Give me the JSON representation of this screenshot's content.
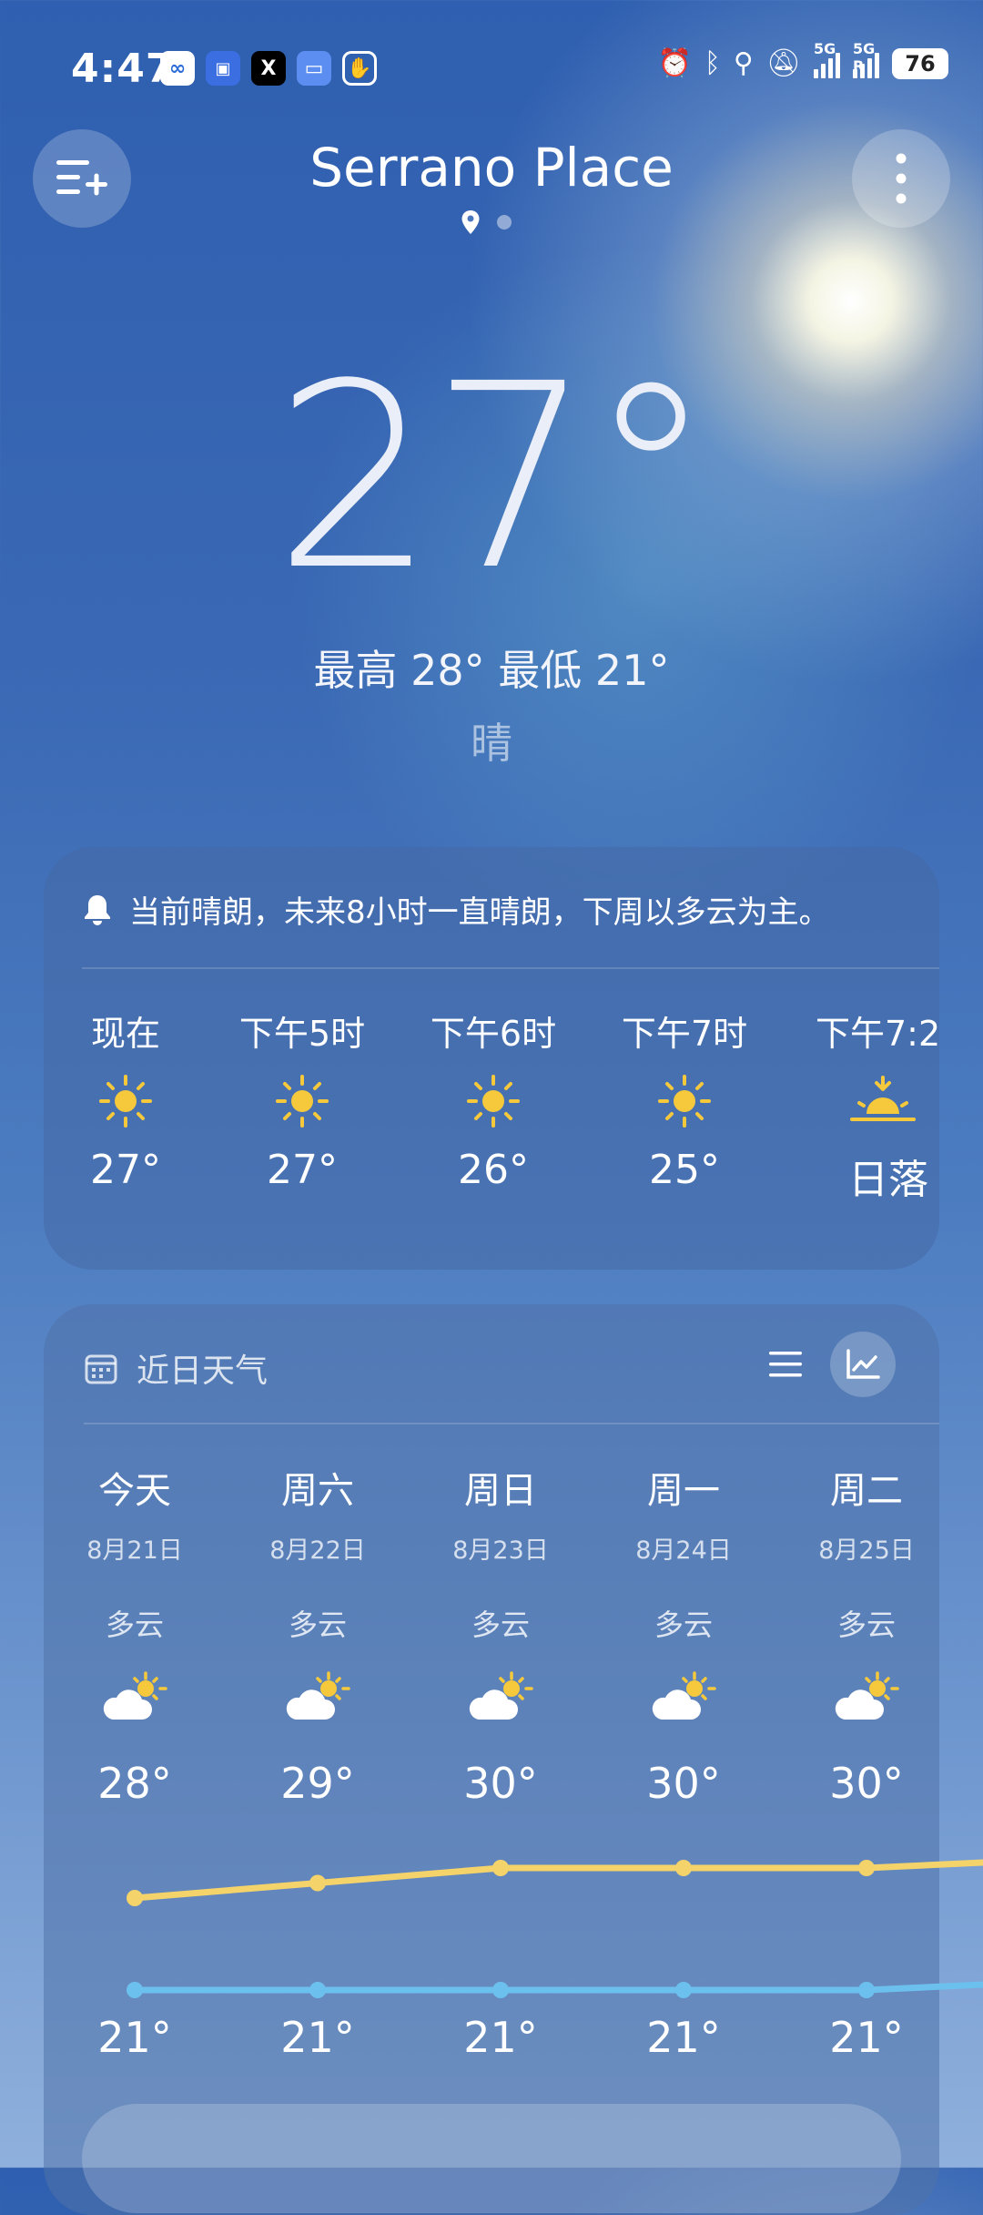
{
  "status_bar": {
    "time": "4:47",
    "network_labels": [
      "5G",
      "5G R"
    ],
    "battery": "76"
  },
  "header": {
    "location": "Serrano Place",
    "add_icon": "list-add-icon",
    "menu_icon": "more-vertical-icon"
  },
  "current": {
    "temperature": "27°",
    "high_low": "最高 28° 最低 21°",
    "condition": "晴"
  },
  "hourly": {
    "alert": "当前晴朗，未来8小时一直晴朗，下周以多云为主。",
    "items": [
      {
        "label": "现在",
        "icon": "sun-icon",
        "value": "27°"
      },
      {
        "label": "下午5时",
        "icon": "sun-icon",
        "value": "27°"
      },
      {
        "label": "下午6时",
        "icon": "sun-icon",
        "value": "26°"
      },
      {
        "label": "下午7时",
        "icon": "sun-icon",
        "value": "25°"
      },
      {
        "label": "下午7:2",
        "icon": "sunset-icon",
        "value": "日落"
      }
    ]
  },
  "daily": {
    "title": "近日天气",
    "days": [
      {
        "name": "今天",
        "date": "8月21日",
        "cond": "多云",
        "high": "28°",
        "low": "21°",
        "high_val": 28,
        "low_val": 21
      },
      {
        "name": "周六",
        "date": "8月22日",
        "cond": "多云",
        "high": "29°",
        "low": "21°",
        "high_val": 29,
        "low_val": 21
      },
      {
        "name": "周日",
        "date": "8月23日",
        "cond": "多云",
        "high": "30°",
        "low": "21°",
        "high_val": 30,
        "low_val": 21
      },
      {
        "name": "周一",
        "date": "8月24日",
        "cond": "多云",
        "high": "30°",
        "low": "21°",
        "high_val": 30,
        "low_val": 21
      },
      {
        "name": "周二",
        "date": "8月25日",
        "cond": "多云",
        "high": "30°",
        "low": "21°",
        "high_val": 30,
        "low_val": 21
      }
    ]
  },
  "colors": {
    "high_line": "#f4d36a",
    "low_line": "#6cc0ee",
    "sun": "#f6c93d"
  }
}
